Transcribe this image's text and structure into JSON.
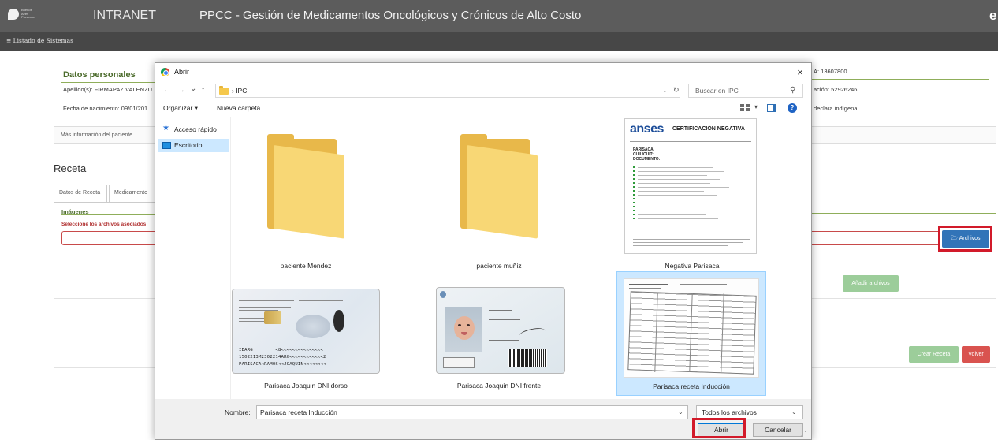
{
  "app": {
    "logo_text": "Buenos\nAires\nProvincia",
    "name": "INTRANET",
    "title": "PPCC - Gestión de Medicamentos Oncológicos y Crónicos de Alto Costo",
    "user_initial": "e",
    "menu_label": "≡ Listado de Sistemas"
  },
  "patient": {
    "section_title": "Datos personales",
    "apellido": "Apellido(s): FIRMAPAZ VALENZU",
    "fecha_nac": "Fecha de nacimiento: 09/01/201",
    "right_1": "A: 13607800",
    "right_2": "ación: 52926246",
    "right_3": "declara indígena",
    "more_info": "Más información del paciente"
  },
  "receta": {
    "title": "Receta",
    "tabs": [
      "Datos de Receta",
      "Medicamento"
    ],
    "imagenes_label": "Imágenes",
    "select_label": "Seleccione los archivos asociados",
    "archivos_button": "Archivos",
    "anadir_button": "Añadir archivos",
    "crear_button": "Crear Receta",
    "volver_button": "Volver"
  },
  "dialog": {
    "title": "Abrir",
    "close": "×",
    "nav": {
      "back": "←",
      "forward": "→",
      "recent": "⌄",
      "up": "↑"
    },
    "address": "› IPC",
    "search_placeholder": "Buscar en IPC",
    "toolbar": {
      "organize": "Organizar ▾",
      "new_folder": "Nueva carpeta",
      "help": "?"
    },
    "sidebar": [
      {
        "label": "Acceso rápido",
        "icon": "star-icon",
        "selected": false
      },
      {
        "label": "Escritorio",
        "icon": "desktop-icon",
        "selected": true
      }
    ],
    "files": [
      {
        "label": "paciente Mendez",
        "type": "folder"
      },
      {
        "label": "paciente muñiz",
        "type": "folder"
      },
      {
        "label": "Negativa Parisaca",
        "type": "anses-document"
      },
      {
        "label": "Parisaca Joaquin DNI dorso",
        "type": "id-card-back"
      },
      {
        "label": "Parisaca Joaquin DNI frente",
        "type": "id-card-front"
      },
      {
        "label": "Parisaca receta Inducción",
        "type": "scan",
        "selected": true
      }
    ],
    "anses": {
      "logo": "anses",
      "heading": "CERTIFICACIÓN NEGATIVA",
      "fields": [
        "PARISACA",
        "CUIL/CUIT:",
        "DOCUMENTO:"
      ]
    },
    "mrz": [
      "IDARG        <8<<<<<<<<<<<<<<<",
      "1502213M2302214ARG<<<<<<<<<<<<2",
      "PARISACA<RAMOS<<JOAQUIN<<<<<<<<"
    ],
    "filename_label": "Nombre:",
    "filename_value": "Parisaca receta Inducción",
    "filter_value": "Todos los archivos",
    "open_button": "Abrir",
    "cancel_button": "Cancelar"
  },
  "colors": {
    "highlight": "#d21a2a",
    "archivos_blue": "#3174b8",
    "selection": "#cce8ff",
    "green_button": "#9ccd9a",
    "volver_red": "#d9534f"
  }
}
